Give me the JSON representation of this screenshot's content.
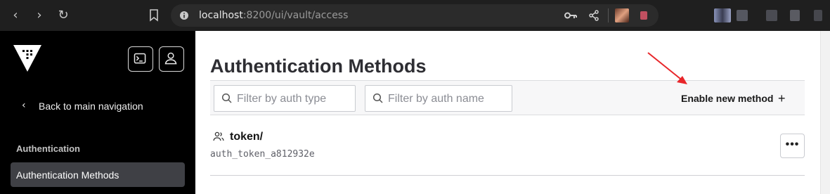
{
  "browser": {
    "url_host": "localhost",
    "url_rest": ":8200/ui/vault/access",
    "colors": {
      "chrome": "#1f1f1f",
      "urlbar": "#2b2b2b"
    }
  },
  "sidebar": {
    "back_label": "Back to main navigation",
    "section_title": "Authentication",
    "active_item": "Authentication Methods"
  },
  "main": {
    "title": "Authentication Methods",
    "filter_type_placeholder": "Filter by auth type",
    "filter_name_placeholder": "Filter by auth name",
    "enable_label": "Enable new method",
    "enable_plus": "+",
    "methods": [
      {
        "path": "token/",
        "accessor": "auth_token_a812932e",
        "more": "•••"
      }
    ]
  },
  "colors": {
    "annotation_arrow": "#e8262a",
    "active_nav": "#3f4045"
  }
}
